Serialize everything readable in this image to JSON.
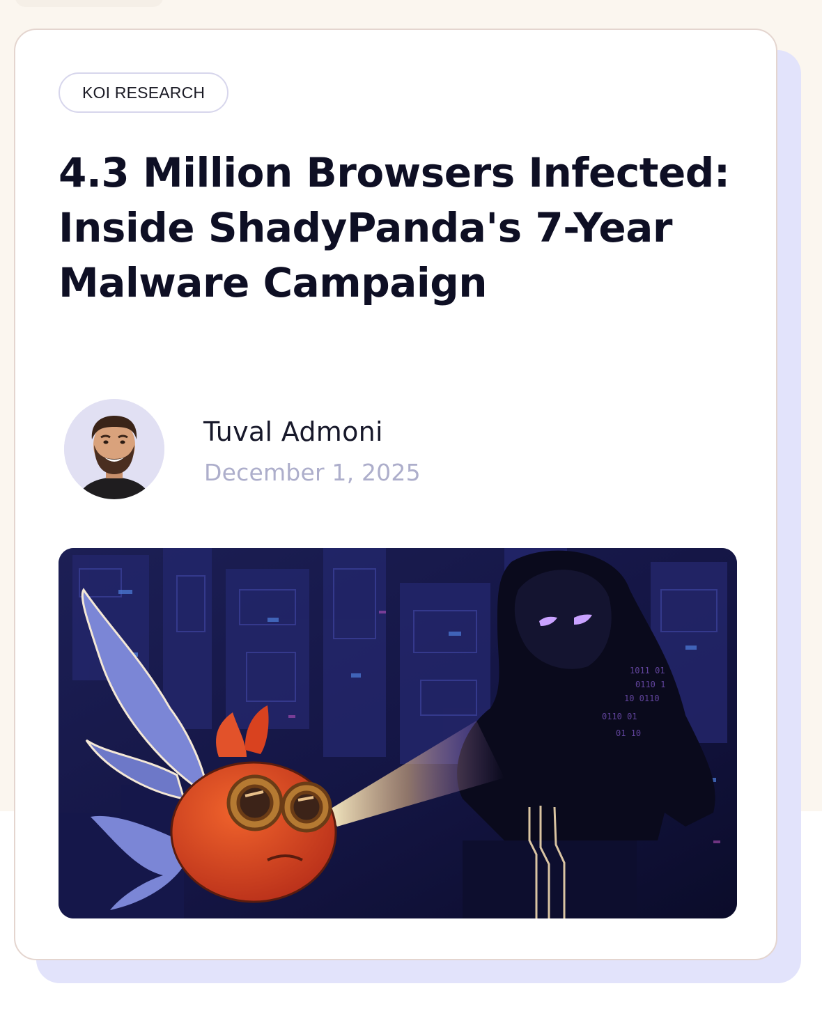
{
  "article": {
    "tag": "KOI RESEARCH",
    "title": "4.3 Million Browsers Infected: Inside ShadyPanda's 7-Year Malware Campaign",
    "author": {
      "name": "Tuval Admoni",
      "avatar_icon": "author-photo"
    },
    "date": "December 1, 2025",
    "hero_image": {
      "icon": "illustration-fish-with-goggles-and-hooded-figure"
    }
  },
  "colors": {
    "page_background": "#fbf6ef",
    "card_shadow": "#e2e3fb",
    "card_border": "#e4d5cf",
    "tag_border": "#d7d6ec",
    "title_text": "#0e0f24",
    "date_text": "#adaecb",
    "avatar_background": "#e1e0f3"
  }
}
